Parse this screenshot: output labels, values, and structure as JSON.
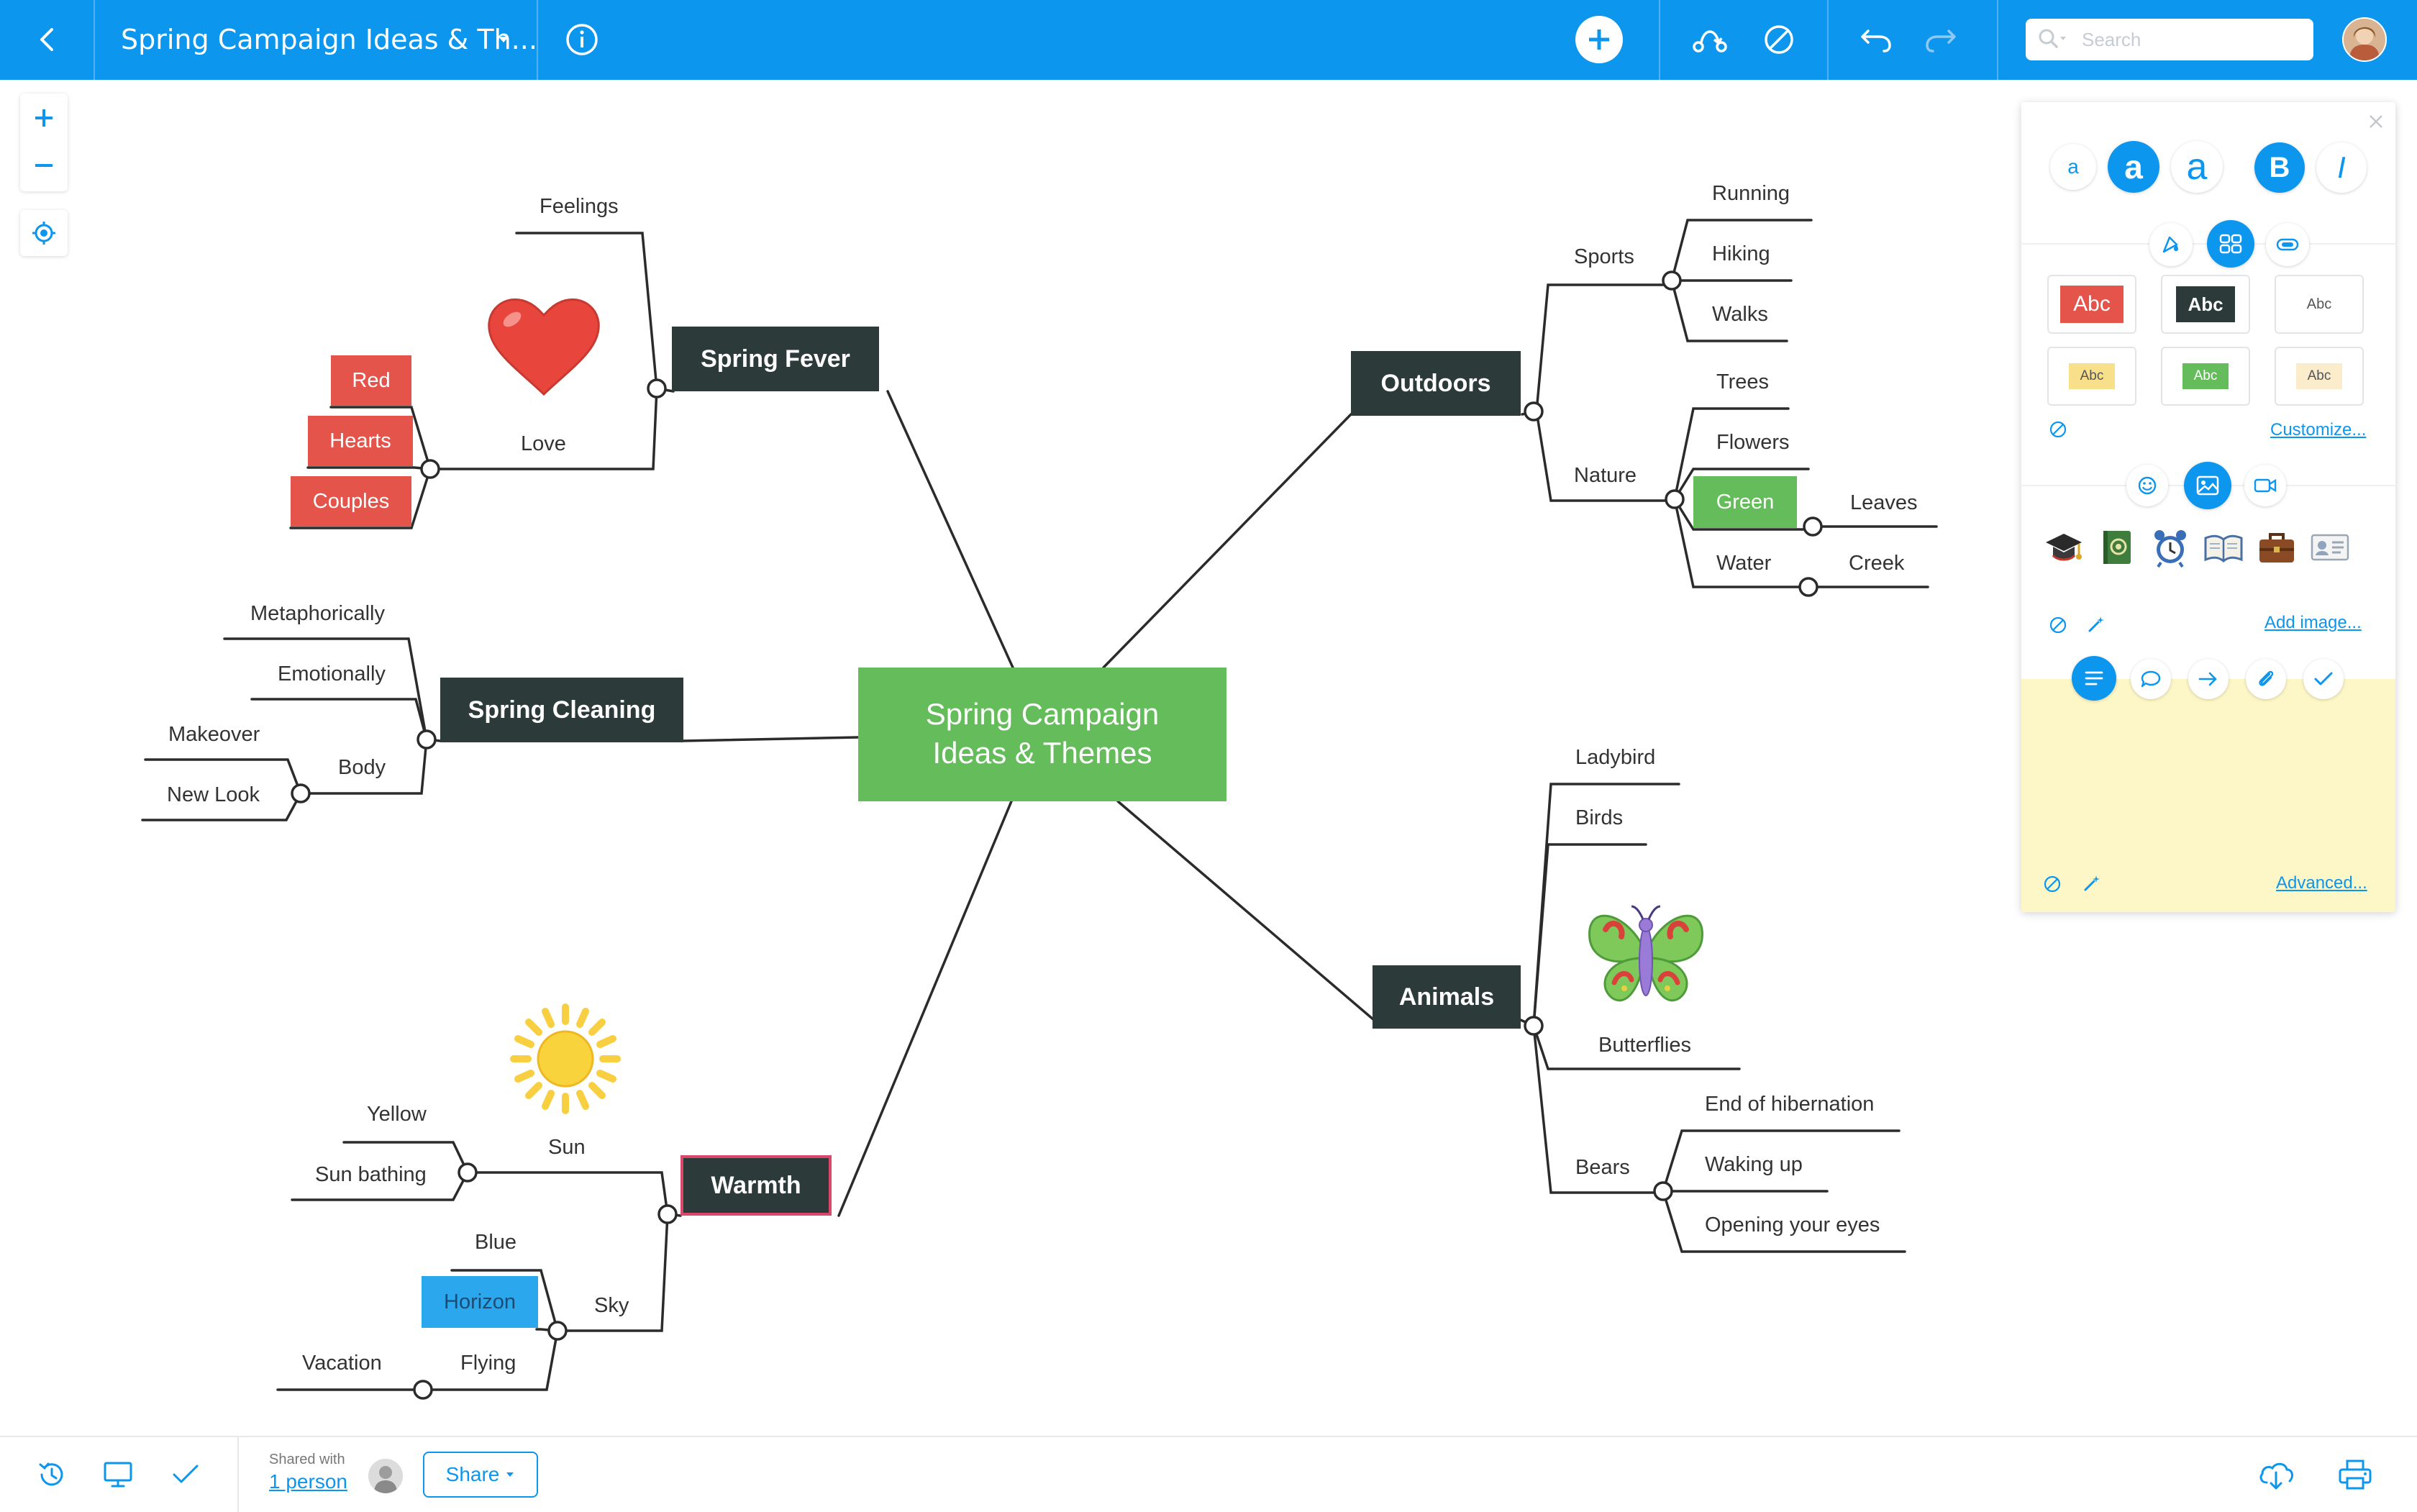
{
  "app": {
    "title": "Spring Campaign Ideas & Th...",
    "search_placeholder": "Search"
  },
  "colors": {
    "brand": "#0c96ee",
    "central": "#64bd5a",
    "topic": "#2c3a3a",
    "tag_red": "#e5544b",
    "tag_green": "#64bd5a",
    "tag_blue": "#2ba7ee",
    "note_yellow": "#fdf6c6"
  },
  "map": {
    "central": "Spring Campaign Ideas & Themes",
    "topics": {
      "spring_fever": "Spring Fever",
      "spring_cleaning": "Spring Cleaning",
      "warmth": "Warmth",
      "outdoors": "Outdoors",
      "animals": "Animals"
    },
    "spring_fever": {
      "feelings": "Feelings",
      "love": "Love",
      "red": "Red",
      "hearts": "Hearts",
      "couples": "Couples"
    },
    "spring_cleaning": {
      "metaphorically": "Metaphorically",
      "emotionally": "Emotionally",
      "body": "Body",
      "makeover": "Makeover",
      "new_look": "New Look"
    },
    "warmth": {
      "sun": "Sun",
      "yellow": "Yellow",
      "sun_bathing": "Sun bathing",
      "sky": "Sky",
      "blue": "Blue",
      "horizon": "Horizon",
      "flying": "Flying",
      "vacation": "Vacation"
    },
    "outdoors": {
      "sports": "Sports",
      "running": "Running",
      "hiking": "Hiking",
      "walks": "Walks",
      "nature": "Nature",
      "trees": "Trees",
      "flowers": "Flowers",
      "green": "Green",
      "leaves": "Leaves",
      "water": "Water",
      "creek": "Creek"
    },
    "animals": {
      "ladybird": "Ladybird",
      "birds": "Birds",
      "butterflies": "Butterflies",
      "bears": "Bears",
      "end_of_hibernation": "End of hibernation",
      "waking_up": "Waking up",
      "opening_your_eyes": "Opening your eyes"
    }
  },
  "panel": {
    "text_sizes": [
      "a",
      "a",
      "a"
    ],
    "bold": "B",
    "italic": "I",
    "style_samples": [
      "Abc",
      "Abc",
      "Abc",
      "Abc",
      "Abc",
      "Abc"
    ],
    "customize_link": "Customize...",
    "add_image_link": "Add image...",
    "advanced_link": "Advanced..."
  },
  "bottom": {
    "shared_with": "Shared with",
    "shared_people": "1 person",
    "share_button": "Share"
  }
}
